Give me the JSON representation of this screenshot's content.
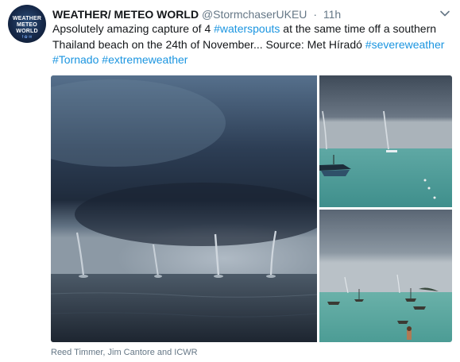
{
  "tweet": {
    "avatar": {
      "line1": "WEATHER",
      "line2": "METEO",
      "line3": "WORLD",
      "icons": "f ✿ ✉"
    },
    "display_name": "WEATHER/ METEO WORLD",
    "handle": "@StormchaserUKEU",
    "separator": "·",
    "timestamp": "11h",
    "caret_icon": "chevron-down-icon",
    "text": {
      "line1_pre": "Apsolutely amazing capture of 4 ",
      "line1_tag": "#waterspouts",
      "line1_post": " at the same time  off a southern",
      "line2_pre": "Thailand beach on the 24th of November... Source: Met Híradó ",
      "line2_tag": "#severeweather",
      "line3_tag1": "#Tornado",
      "line3_sep": " ",
      "line3_tag2": "#extremeweather"
    },
    "media_credit": "Reed Timmer, Jim Cantore and ICWR",
    "colors": {
      "hashtag": "#1b95e0",
      "secondary_text": "#657786",
      "primary_text": "#14171a"
    }
  }
}
